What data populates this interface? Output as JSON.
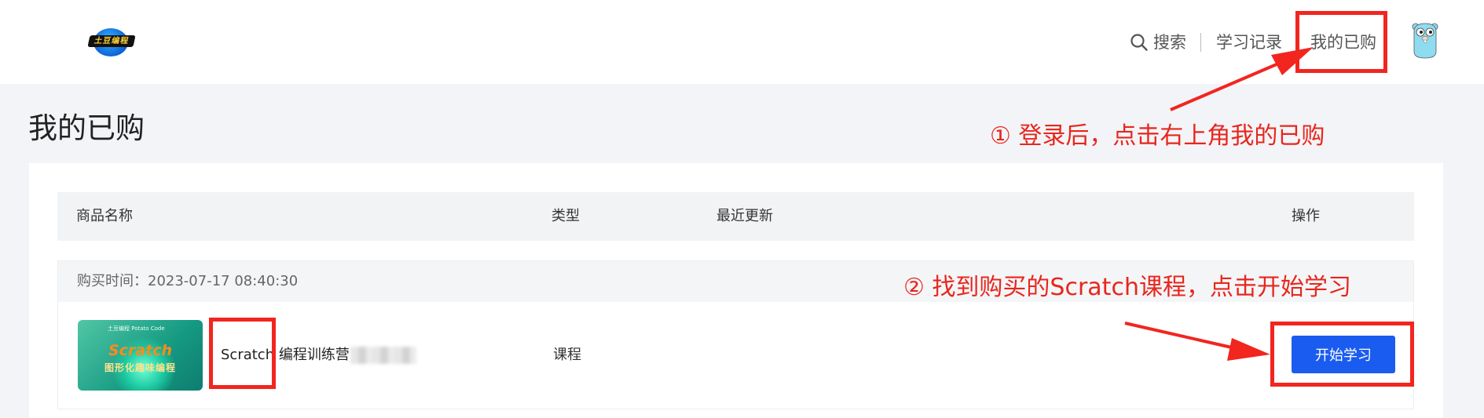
{
  "header": {
    "logo_text": "土豆编程",
    "search_label": "搜索",
    "history_label": "学习记录",
    "purchased_label": "我的已购"
  },
  "page": {
    "title": "我的已购"
  },
  "table": {
    "headers": {
      "name": "商品名称",
      "type": "类型",
      "updated": "最近更新",
      "action": "操作"
    }
  },
  "order": {
    "purchase_time": "购买时间：2023-07-17 08:40:30",
    "thumbnail": {
      "brand": "土豆编程 Potato Code",
      "title": "Scratch",
      "subtitle": "图形化趣味编程"
    },
    "course_name": "Scratch 编程训练营",
    "course_type": "课程",
    "start_button": "开始学习"
  },
  "annotations": {
    "step1": "① 登录后，点击右上角我的已购",
    "step2": "② 找到购买的Scratch课程，点击开始学习",
    "color": "#f2251f"
  },
  "colors": {
    "primary_button": "#1b5cf0",
    "page_bg": "#f3f4f7"
  }
}
